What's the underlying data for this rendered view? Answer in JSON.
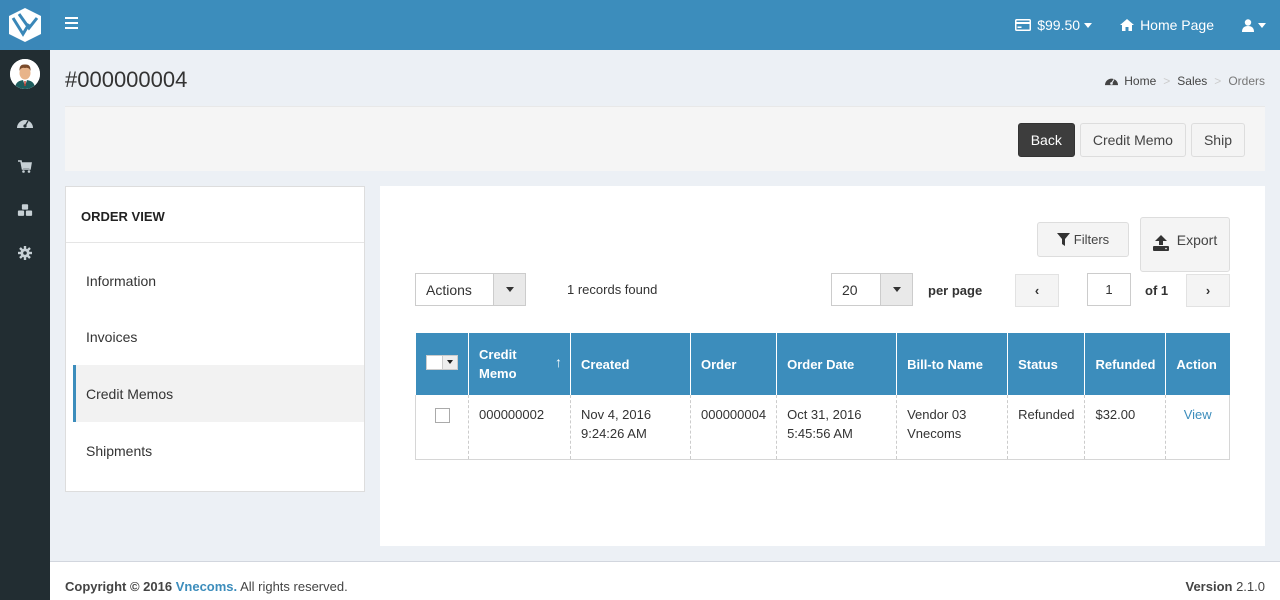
{
  "topbar": {
    "balance": "$99.50",
    "home_page": "Home Page"
  },
  "page": {
    "title": "#000000004"
  },
  "breadcrumb": [
    "Home",
    "Sales",
    "Orders"
  ],
  "actions": {
    "back": "Back",
    "credit_memo": "Credit Memo",
    "ship": "Ship"
  },
  "order_view": {
    "heading": "ORDER VIEW",
    "items": [
      {
        "label": "Information",
        "active": false
      },
      {
        "label": "Invoices",
        "active": false
      },
      {
        "label": "Credit Memos",
        "active": true
      },
      {
        "label": "Shipments",
        "active": false
      }
    ]
  },
  "grid": {
    "filters_label": "Filters",
    "export_label": "Export",
    "actions_select": "Actions",
    "records_found": "1 records found",
    "per_page_value": "20",
    "per_page_label": "per page",
    "current_page": "1",
    "of_pages": "of 1",
    "columns": [
      "Credit Memo",
      "Created",
      "Order",
      "Order Date",
      "Bill-to Name",
      "Status",
      "Refunded",
      "Action"
    ],
    "rows": [
      {
        "credit_memo": "000000002",
        "created_date": "Nov 4, 2016",
        "created_time": "9:24:26 AM",
        "order": "000000004",
        "order_date": "Oct 31, 2016",
        "order_time": "5:45:56 AM",
        "bill_to_first": "Vendor 03",
        "bill_to_last": "Vnecoms",
        "status": "Refunded",
        "refunded": "$32.00",
        "action": "View"
      }
    ]
  },
  "footer": {
    "copyright_prefix": "Copyright © 2016",
    "brand": "Vnecoms.",
    "rights": "All rights reserved.",
    "version_label": "Version",
    "version": "2.1.0"
  },
  "colors": {
    "primary": "#3c8dbc",
    "sidebar": "#222d32",
    "dark_button": "#3d3d3d"
  }
}
